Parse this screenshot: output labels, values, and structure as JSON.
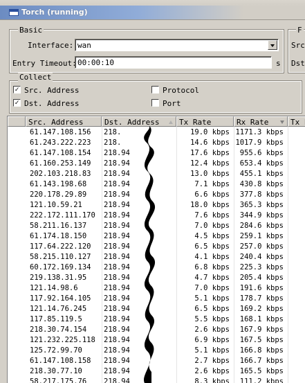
{
  "window": {
    "title": "Torch (running)"
  },
  "basic": {
    "label": "Basic",
    "interface_label": "Interface:",
    "interface_value": "wan",
    "timeout_label": "Entry Timeout:",
    "timeout_value": "00:00:10",
    "timeout_unit": "s"
  },
  "right_group": {
    "label": "F",
    "src_label": "Src",
    "dst_label": "Dst"
  },
  "collect": {
    "label": "Collect",
    "src_address": {
      "label": "Src. Address",
      "checked": true
    },
    "dst_address": {
      "label": "Dst. Address",
      "checked": true
    },
    "protocol": {
      "label": "Protocol",
      "checked": false
    },
    "port": {
      "label": "Port",
      "checked": false
    }
  },
  "table": {
    "headers": [
      "Src. Address",
      "Dst. Address",
      "Tx Rate",
      "Rx Rate",
      "Tx P"
    ],
    "rows": [
      {
        "src": "61.147.108.156",
        "dst": "218.",
        "tx": "19.0 kbps",
        "rx": "1171.3 kbps"
      },
      {
        "src": "61.243.222.223",
        "dst": "218.",
        "tx": "14.6 kbps",
        "rx": "1017.9 kbps"
      },
      {
        "src": "61.147.108.154",
        "dst": "218.94",
        "tx": "17.6 kbps",
        "rx": "955.6 kbps"
      },
      {
        "src": "61.160.253.149",
        "dst": "218.94",
        "tx": "12.4 kbps",
        "rx": "653.4 kbps"
      },
      {
        "src": "202.103.218.83",
        "dst": "218.94",
        "tx": "13.0 kbps",
        "rx": "455.1 kbps"
      },
      {
        "src": "61.143.198.68",
        "dst": "218.94",
        "tx": "7.1 kbps",
        "rx": "430.8 kbps"
      },
      {
        "src": "220.178.29.89",
        "dst": "218.94",
        "tx": "6.6 kbps",
        "rx": "377.8 kbps"
      },
      {
        "src": "121.10.59.21",
        "dst": "218.94",
        "tx": "18.0 kbps",
        "rx": "365.3 kbps"
      },
      {
        "src": "222.172.111.170",
        "dst": "218.94",
        "tx": "7.6 kbps",
        "rx": "344.9 kbps"
      },
      {
        "src": "58.211.16.137",
        "dst": "218.94",
        "tx": "7.0 kbps",
        "rx": "284.6 kbps"
      },
      {
        "src": "61.174.18.150",
        "dst": "218.94",
        "tx": "4.5 kbps",
        "rx": "259.1 kbps"
      },
      {
        "src": "117.64.222.120",
        "dst": "218.94",
        "tx": "6.5 kbps",
        "rx": "257.0 kbps"
      },
      {
        "src": "58.215.110.127",
        "dst": "218.94",
        "tx": "4.1 kbps",
        "rx": "240.4 kbps"
      },
      {
        "src": "60.172.169.134",
        "dst": "218.94",
        "tx": "6.8 kbps",
        "rx": "225.3 kbps"
      },
      {
        "src": "219.138.31.95",
        "dst": "218.94",
        "tx": "4.7 kbps",
        "rx": "205.4 kbps"
      },
      {
        "src": "121.14.98.6",
        "dst": "218.94",
        "tx": "7.0 kbps",
        "rx": "191.6 kbps"
      },
      {
        "src": "117.92.164.105",
        "dst": "218.94",
        "tx": "5.1 kbps",
        "rx": "178.7 kbps"
      },
      {
        "src": "121.14.76.245",
        "dst": "218.94",
        "tx": "6.5 kbps",
        "rx": "169.2 kbps"
      },
      {
        "src": "117.85.119.5",
        "dst": "218.94",
        "tx": "5.5 kbps",
        "rx": "168.1 kbps"
      },
      {
        "src": "218.30.74.154",
        "dst": "218.94",
        "tx": "2.6 kbps",
        "rx": "167.9 kbps"
      },
      {
        "src": "121.232.225.118",
        "dst": "218.94",
        "tx": "6.9 kbps",
        "rx": "167.5 kbps"
      },
      {
        "src": "125.72.99.70",
        "dst": "218.94",
        "tx": "5.1 kbps",
        "rx": "166.8 kbps"
      },
      {
        "src": "61.147.108.158",
        "dst": "218.94",
        "tx": "2.7 kbps",
        "rx": "166.7 kbps"
      },
      {
        "src": "218.30.77.10",
        "dst": "218.94",
        "tx": "2.6 kbps",
        "rx": "165.5 kbps"
      },
      {
        "src": "58.217.175.76",
        "dst": "218.94",
        "tx": "8.3 kbps",
        "rx": "111.2 kbps"
      }
    ]
  }
}
